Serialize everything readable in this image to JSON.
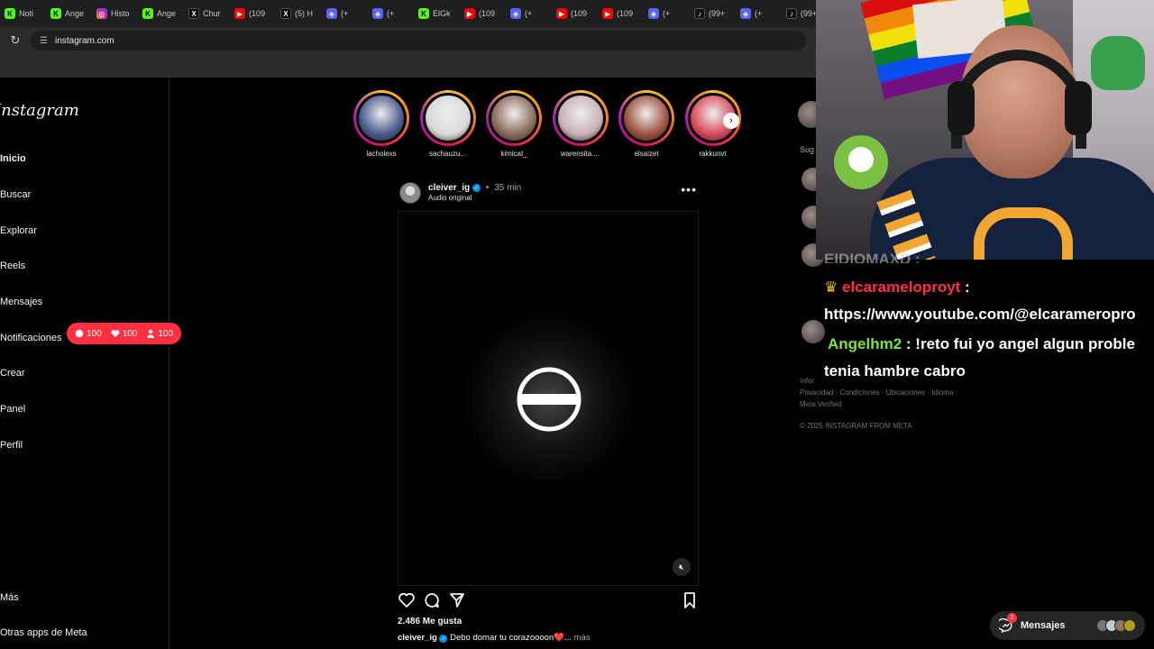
{
  "browser": {
    "tabs": [
      {
        "icon": "kick-icon",
        "label": "Noti",
        "kind": "k"
      },
      {
        "icon": "kick-icon",
        "label": "Ange",
        "kind": "k"
      },
      {
        "icon": "instagram-icon",
        "label": "Histo",
        "kind": "ig"
      },
      {
        "icon": "kick-icon",
        "label": "Ange",
        "kind": "k"
      },
      {
        "icon": "x-icon",
        "label": "Chur",
        "kind": "x"
      },
      {
        "icon": "youtube-icon",
        "label": "(109",
        "kind": "yt"
      },
      {
        "icon": "x-icon",
        "label": "(5) H",
        "kind": "x"
      },
      {
        "icon": "discord-icon",
        "label": "(+",
        "kind": "d"
      },
      {
        "icon": "discord-icon",
        "label": "(+",
        "kind": "d"
      },
      {
        "icon": "kick-icon",
        "label": "ElGk",
        "kind": "k"
      },
      {
        "icon": "youtube-icon",
        "label": "(109",
        "kind": "yt"
      },
      {
        "icon": "discord-icon",
        "label": "(+",
        "kind": "d"
      },
      {
        "icon": "youtube-icon",
        "label": "(109",
        "kind": "yt"
      },
      {
        "icon": "youtube-icon",
        "label": "(109",
        "kind": "yt"
      },
      {
        "icon": "discord-icon",
        "label": "(+",
        "kind": "d"
      },
      {
        "icon": "tiktok-icon",
        "label": "(99+",
        "kind": "tt"
      },
      {
        "icon": "discord-icon",
        "label": "(+",
        "kind": "d"
      },
      {
        "icon": "tiktok-icon",
        "label": "(99+",
        "kind": "tt"
      }
    ],
    "url": "instagram.com"
  },
  "sidebar": {
    "logo": "Instagram",
    "items": [
      {
        "label": "Inicio",
        "active": true
      },
      {
        "label": "Buscar"
      },
      {
        "label": "Explorar"
      },
      {
        "label": "Reels"
      },
      {
        "label": "Mensajes"
      },
      {
        "label": "Notificaciones"
      },
      {
        "label": "Crear"
      },
      {
        "label": "Panel"
      },
      {
        "label": "Perfil"
      }
    ],
    "bottom_items": [
      {
        "label": "Más"
      },
      {
        "label": "Otras apps de Meta"
      }
    ],
    "notif_pill": {
      "comments": "100",
      "likes": "100",
      "follows": "100"
    }
  },
  "stories": [
    {
      "name": "lacholexs",
      "color": "#4a5a8a"
    },
    {
      "name": "sachauzu...",
      "color": "#d9d9d9"
    },
    {
      "name": "kimicat_",
      "color": "#8a6a58"
    },
    {
      "name": "warensita....",
      "color": "#c9aeb8"
    },
    {
      "name": "elsaizet",
      "color": "#9a5040"
    },
    {
      "name": "rakkunvt",
      "color": "#d94a5a"
    }
  ],
  "post": {
    "username": "cleiver_ig",
    "time": "35 min",
    "audio": "Audio original",
    "likes": "2.486 Me gusta",
    "caption_user": "cleiver_ig",
    "caption_text": "Debo domar tu corazoooon❤️...",
    "caption_more": "más"
  },
  "right_column": {
    "suggestions_title": "Sug",
    "footer_line1": "Infor",
    "footer_line2": "Privacidad · Condiciones · Ubicaciones · Idioma ·",
    "footer_line3": "Meta Verified",
    "copyright": "© 2025 INSTAGRAM FROM META"
  },
  "chat": {
    "messages": [
      {
        "user": "elcarameloproyt",
        "sep": " :",
        "line2": "https://www.youtube.com/@elcarameropro"
      },
      {
        "user": "Angelhm2",
        "sep": " : ",
        "text": "!reto fui yo angel algun proble",
        "line2": "tenia hambre cabro"
      }
    ],
    "clipped_line": "EIDIOMAXD :"
  },
  "messages_bar": {
    "label": "Mensajes",
    "badge": "3"
  }
}
